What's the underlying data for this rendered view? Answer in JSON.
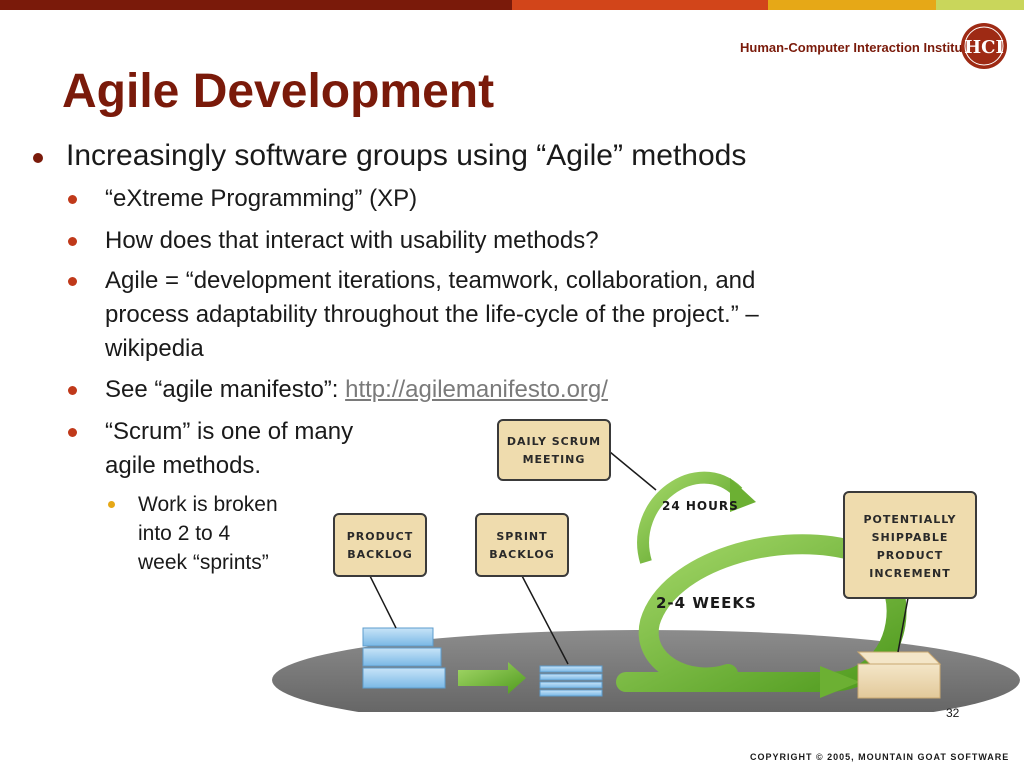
{
  "header": {
    "institute": "Human-Computer Interaction Institute",
    "logo_text": "HCI",
    "bar_colors": [
      "#7a1a0a",
      "#d2451a",
      "#e6a817",
      "#c9d65b"
    ]
  },
  "slide": {
    "title": "Agile Development",
    "bullet1": "Increasingly software groups using “Agile” methods",
    "sub1": "“eXtreme Programming” (XP)",
    "sub2": "How does that interact with usability methods?",
    "sub3_line1": "Agile = “development iterations, teamwork, collaboration, and",
    "sub3_line2": "process adaptability throughout the life-cycle of the project.” –",
    "sub3_line3": "wikipedia",
    "sub4_prefix": "See “agile manifesto”: ",
    "sub4_link": "http://agilemanifesto.org/",
    "sub5_line1": "“Scrum” is one of many",
    "sub5_line2": "agile methods.",
    "subsub1_line1": "Work is broken",
    "subsub1_line2": "into 2 to 4",
    "subsub1_line3": "week “sprints”"
  },
  "diagram": {
    "daily_scrum_1": "Daily Scrum",
    "daily_scrum_2": "Meeting",
    "product_backlog_1": "Product",
    "product_backlog_2": "Backlog",
    "sprint_backlog_1": "Sprint",
    "sprint_backlog_2": "Backlog",
    "shippable_1": "Potentially",
    "shippable_2": "Shippable",
    "shippable_3": "Product",
    "shippable_4": "Increment",
    "hours_label": "24 Hours",
    "weeks_label": "2-4 Weeks",
    "accent_green": "#7fc241",
    "note_fill": "#efdcae"
  },
  "footer": {
    "page_number": "32",
    "copyright": "Copyright © 2005, Mountain Goat Software"
  }
}
